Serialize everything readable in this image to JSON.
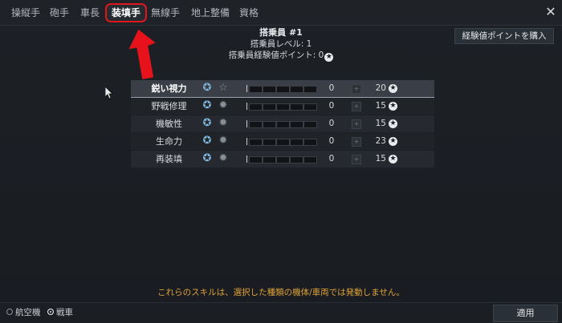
{
  "tabs": [
    {
      "label": "操縦手",
      "active": false
    },
    {
      "label": "砲手",
      "active": false
    },
    {
      "label": "車長",
      "active": false
    },
    {
      "label": "装填手",
      "active": true
    },
    {
      "label": "無線手",
      "active": false
    },
    {
      "label": "地上整備",
      "active": false
    },
    {
      "label": "資格",
      "active": false
    }
  ],
  "close_icon": "close-icon",
  "crew": {
    "title": "搭乗員 #1",
    "level_label": "搭乗員レベル: 1",
    "xp_label": "搭乗員経験値ポイント: 0"
  },
  "buy_button": "経験値ポイントを購入",
  "skills": [
    {
      "name": "鋭い視力",
      "level": "0",
      "cost": "20",
      "selected": true
    },
    {
      "name": "野戦修理",
      "level": "0",
      "cost": "15",
      "selected": false
    },
    {
      "name": "機敏性",
      "level": "0",
      "cost": "15",
      "selected": false
    },
    {
      "name": "生命力",
      "level": "0",
      "cost": "23",
      "selected": false
    },
    {
      "name": "再装填",
      "level": "0",
      "cost": "15",
      "selected": false
    }
  ],
  "notice": "これらのスキルは、選択した種類の機体/車両では発動しません。",
  "vehicle_types": [
    {
      "label": "航空機",
      "selected": false
    },
    {
      "label": "戦車",
      "selected": true
    }
  ],
  "apply_button": "適用",
  "colors": {
    "accent_red": "#e0161f",
    "notice_orange": "#e0a237",
    "skill_icon_blue": "#7fb5dc"
  }
}
